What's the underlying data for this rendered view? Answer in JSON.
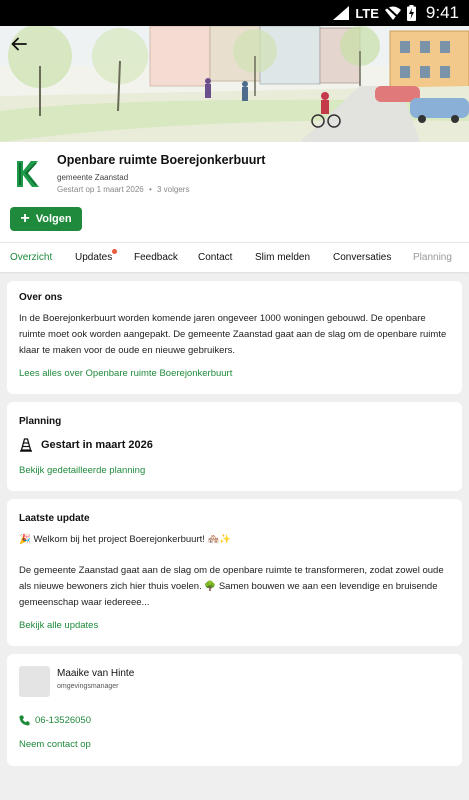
{
  "status_bar": {
    "network": "LTE",
    "time": "9:41",
    "icons": [
      "signal-icon",
      "wifi-off-icon",
      "battery-charging-icon"
    ]
  },
  "hero": {
    "image": "streetscape-sketch",
    "back_icon": "arrow-left-icon"
  },
  "project": {
    "logo_letter": "K",
    "title": "Openbare ruimte Boerejonkerbuurt",
    "organization": "gemeente Zaanstad",
    "started": "Gestart op 1 maart 2026",
    "separator": "•",
    "followers": "3 volgers",
    "follow_label": "Volgen"
  },
  "tabs": [
    {
      "label": "Overzicht"
    },
    {
      "label": "Updates"
    },
    {
      "label": "Feedback"
    },
    {
      "label": "Contact"
    },
    {
      "label": "Slim melden"
    },
    {
      "label": "Conversaties"
    },
    {
      "label": "Planning"
    }
  ],
  "about": {
    "title": "Over ons",
    "text": "In de Boerejonkerbuurt worden komende jaren ongeveer 1000 woningen gebouwd. De openbare ruimte moet ook worden aangepakt. De gemeente Zaanstad gaat aan de slag om de openbare ruimte klaar te maken voor de oude en nieuwe gebruikers.",
    "link": "Lees alles over Openbare ruimte Boerejonkerbuurt"
  },
  "planning": {
    "title": "Planning",
    "status": "Gestart in maart 2026",
    "link": "Bekijk gedetailleerde planning"
  },
  "latest_update": {
    "title": "Laatste update",
    "headline": "🎉 Welkom bij het project Boerejonkerbuurt! 🏘️✨",
    "body": "De gemeente Zaanstad gaat aan de slag om de openbare ruimte te transformeren, zodat zowel oude als nieuwe bewoners zich hier thuis voelen. 🌳 Samen bouwen we aan een levendige en bruisende gemeenschap waar iedereee...",
    "link": "Bekijk alle updates"
  },
  "contact": {
    "name": "Maaike van Hinte",
    "role": "omgevingsmanager",
    "phone": "06-13526050",
    "link": "Neem contact op"
  },
  "colors": {
    "accent": "#1f8a3c",
    "notification": "#e8583a",
    "background": "#efefef"
  }
}
